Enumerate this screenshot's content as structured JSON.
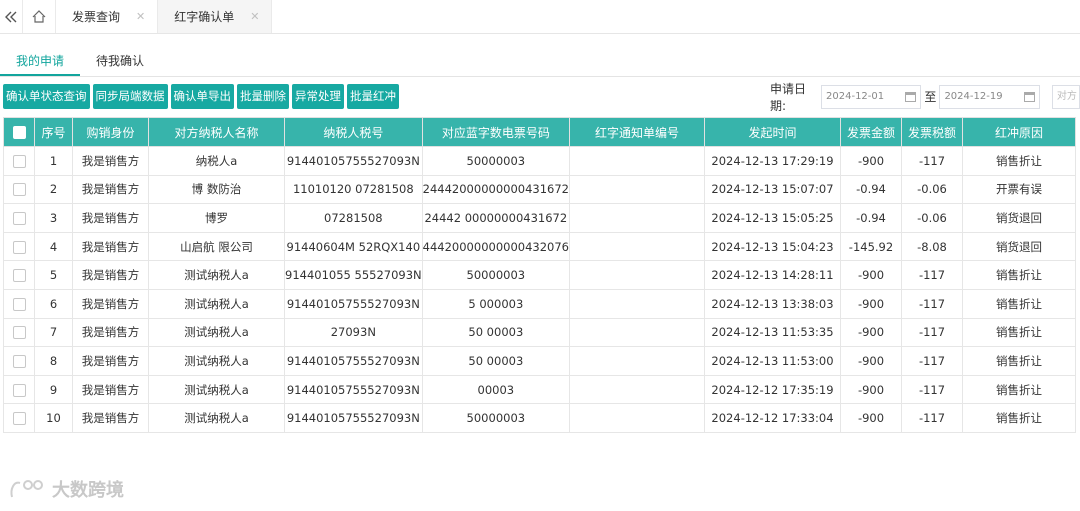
{
  "tabs": [
    {
      "label": "发票查询",
      "active": false
    },
    {
      "label": "红字确认单",
      "active": true
    }
  ],
  "subtabs": [
    {
      "label": "我的申请",
      "active": true
    },
    {
      "label": "待我确认",
      "active": false
    }
  ],
  "toolbar": {
    "buttons": [
      "确认单状态查询",
      "同步局端数据",
      "确认单导出",
      "批量删除",
      "异常处理",
      "批量红冲"
    ]
  },
  "filter": {
    "date_label": "申请日期:",
    "date_from": "2024-12-01",
    "date_sep": "至",
    "date_to": "2024-12-19",
    "next_placeholder": "对方"
  },
  "table": {
    "headers": [
      "序号",
      "购销身份",
      "对方纳税人名称",
      "纳税人税号",
      "对应蓝字数电票号码",
      "红字通知单编号",
      "发起时间",
      "发票金额",
      "发票税额",
      "红冲原因"
    ],
    "rows": [
      {
        "no": "1",
        "role": "我是销售方",
        "name": "纳税人a",
        "tax_id": "91440105755527093N",
        "blue_no": "50000003",
        "notice_no": "",
        "time": "2024-12-13 17:29:19",
        "amount": "-900",
        "tax": "-117",
        "reason": "销售折让"
      },
      {
        "no": "2",
        "role": "我是销售方",
        "name": "博 数防治",
        "tax_id": "11010120 07281508",
        "blue_no": "24442000000000431672",
        "notice_no": "",
        "time": "2024-12-13 15:07:07",
        "amount": "-0.94",
        "tax": "-0.06",
        "reason": "开票有误"
      },
      {
        "no": "3",
        "role": "我是销售方",
        "name": "博罗",
        "tax_id": "07281508",
        "blue_no": "24442 00000000431672",
        "notice_no": "",
        "time": "2024-12-13 15:05:25",
        "amount": "-0.94",
        "tax": "-0.06",
        "reason": "销货退回"
      },
      {
        "no": "4",
        "role": "我是销售方",
        "name": "山启航 限公司",
        "tax_id": "91440604M 52RQX140",
        "blue_no": "44420000000000432076",
        "notice_no": "",
        "time": "2024-12-13 15:04:23",
        "amount": "-145.92",
        "tax": "-8.08",
        "reason": "销货退回"
      },
      {
        "no": "5",
        "role": "我是销售方",
        "name": "测试纳税人a",
        "tax_id": "914401055 55527093N",
        "blue_no": "50000003",
        "notice_no": "",
        "time": "2024-12-13 14:28:11",
        "amount": "-900",
        "tax": "-117",
        "reason": "销售折让"
      },
      {
        "no": "6",
        "role": "我是销售方",
        "name": "测试纳税人a",
        "tax_id": "91440105755527093N",
        "blue_no": "5 000003",
        "notice_no": "",
        "time": "2024-12-13 13:38:03",
        "amount": "-900",
        "tax": "-117",
        "reason": "销售折让"
      },
      {
        "no": "7",
        "role": "我是销售方",
        "name": "测试纳税人a",
        "tax_id": "27093N",
        "blue_no": "50 00003",
        "notice_no": "",
        "time": "2024-12-13 11:53:35",
        "amount": "-900",
        "tax": "-117",
        "reason": "销售折让"
      },
      {
        "no": "8",
        "role": "我是销售方",
        "name": "测试纳税人a",
        "tax_id": "91440105755527093N",
        "blue_no": "50 00003",
        "notice_no": "",
        "time": "2024-12-13 11:53:00",
        "amount": "-900",
        "tax": "-117",
        "reason": "销售折让"
      },
      {
        "no": "9",
        "role": "我是销售方",
        "name": "测试纳税人a",
        "tax_id": "91440105755527093N",
        "blue_no": "00003",
        "notice_no": "",
        "time": "2024-12-12 17:35:19",
        "amount": "-900",
        "tax": "-117",
        "reason": "销售折让"
      },
      {
        "no": "10",
        "role": "我是销售方",
        "name": "测试纳税人a",
        "tax_id": "91440105755527093N",
        "blue_no": "50000003",
        "notice_no": "",
        "time": "2024-12-12 17:33:04",
        "amount": "-900",
        "tax": "-117",
        "reason": "销售折让"
      }
    ]
  },
  "watermark": {
    "text": "大数跨境"
  },
  "icons": {
    "collapse": "double-chevron-left-icon",
    "home": "home-icon",
    "close": "close-icon",
    "calendar": "calendar-icon"
  },
  "colors": {
    "accent": "#17a9a2",
    "header": "#37b4ab"
  }
}
